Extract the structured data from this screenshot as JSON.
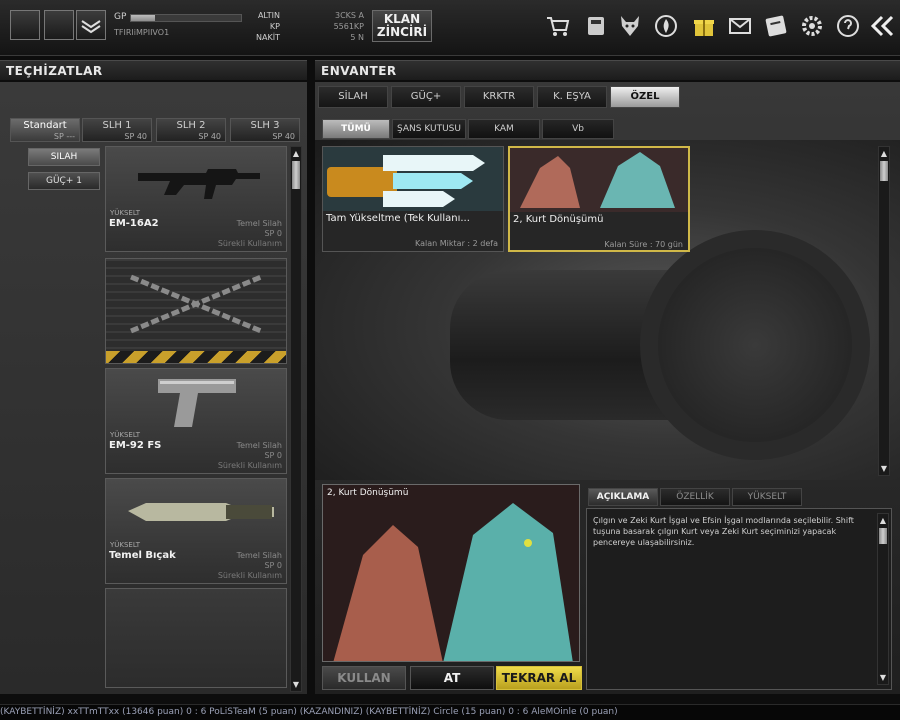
{
  "topbar": {
    "gp_label": "GP",
    "gp_progress": 0.22,
    "nickname": "TFIRIiMPIIVO1",
    "altin_label": "ALTIN",
    "kp_label": "KP",
    "nakit_label": "NAKİT",
    "score_a": "3CKS A",
    "score_b": "5561KP",
    "score_c": "5 N",
    "klan_line1": "KLAN",
    "klan_line2": "ZİNCİRİ",
    "icons": [
      "shop-cart-icon",
      "storage-icon",
      "wolf-icon",
      "fire-icon",
      "gift-icon",
      "mail-icon",
      "book-icon",
      "settings-gear-icon",
      "help-icon",
      "back-arrow-icon"
    ]
  },
  "left": {
    "header": "TEÇHİZATLAR",
    "tabs": [
      {
        "label": "Standart",
        "sp": "SP ---"
      },
      {
        "label": "SLH 1",
        "sp": "SP 40"
      },
      {
        "label": "SLH 2",
        "sp": "SP 40"
      },
      {
        "label": "SLH 3",
        "sp": "SP 40"
      }
    ],
    "sub_buttons": [
      "SILAH",
      "GÜÇ+ 1"
    ],
    "cards": [
      {
        "badge": "YÜKSELT",
        "name": "EM-16A2",
        "type": "Temel Silah",
        "sp": "SP 0",
        "dur": "Sürekli Kullanım"
      },
      {
        "badge": "",
        "name": "",
        "type": "",
        "sp": "",
        "dur": ""
      },
      {
        "badge": "YÜKSELT",
        "name": "EM-92 FS",
        "type": "Temel Silah",
        "sp": "SP 0",
        "dur": "Sürekli Kullanım"
      },
      {
        "badge": "YÜKSELT",
        "name": "Temel Bıçak",
        "type": "Temel Silah",
        "sp": "SP 0",
        "dur": "Sürekli Kullanım"
      }
    ]
  },
  "right": {
    "header": "ENVANTER",
    "tabs": [
      "SİLAH",
      "GÜÇ+",
      "KRKTR",
      "K. EŞYA",
      "ÖZEL"
    ],
    "sub_tabs": [
      "TÜMÜ",
      "ŞANS KUTUSU",
      "KAM",
      "Vb"
    ],
    "items": [
      {
        "name": "Tam Yükseltme (Tek Kullanı...",
        "meta": "Kalan Miktar : 2 defa"
      },
      {
        "name": "2, Kurt Dönüşümü",
        "meta": "Kalan Süre : 70 gün"
      }
    ],
    "preview_title": "2, Kurt Dönüşümü",
    "detail_tabs": [
      "AÇIKLAMA",
      "ÖZELLİK",
      "YÜKSELT"
    ],
    "description": "Çılgın ve Zeki Kurt İşgal ve Efsin İşgal modlarında seçilebilir. Shift tuşuna basarak çılgın Kurt veya Zeki Kurt seçiminizi yapacak pencereye ulaşabilirsiniz.",
    "buttons": {
      "use": "KULLAN",
      "drop": "AT",
      "rebuy": "TEKRAR AL"
    }
  },
  "ticker": "(KAYBETTİNİZ) xxTTmTTxx (13646 puan) 0 : 6 PoLiSTeaM (5 puan) (KAZANDINIZ)          (KAYBETTİNİZ) Circle (15 puan) 0 : 6 AleMOinle (0 puan)"
}
